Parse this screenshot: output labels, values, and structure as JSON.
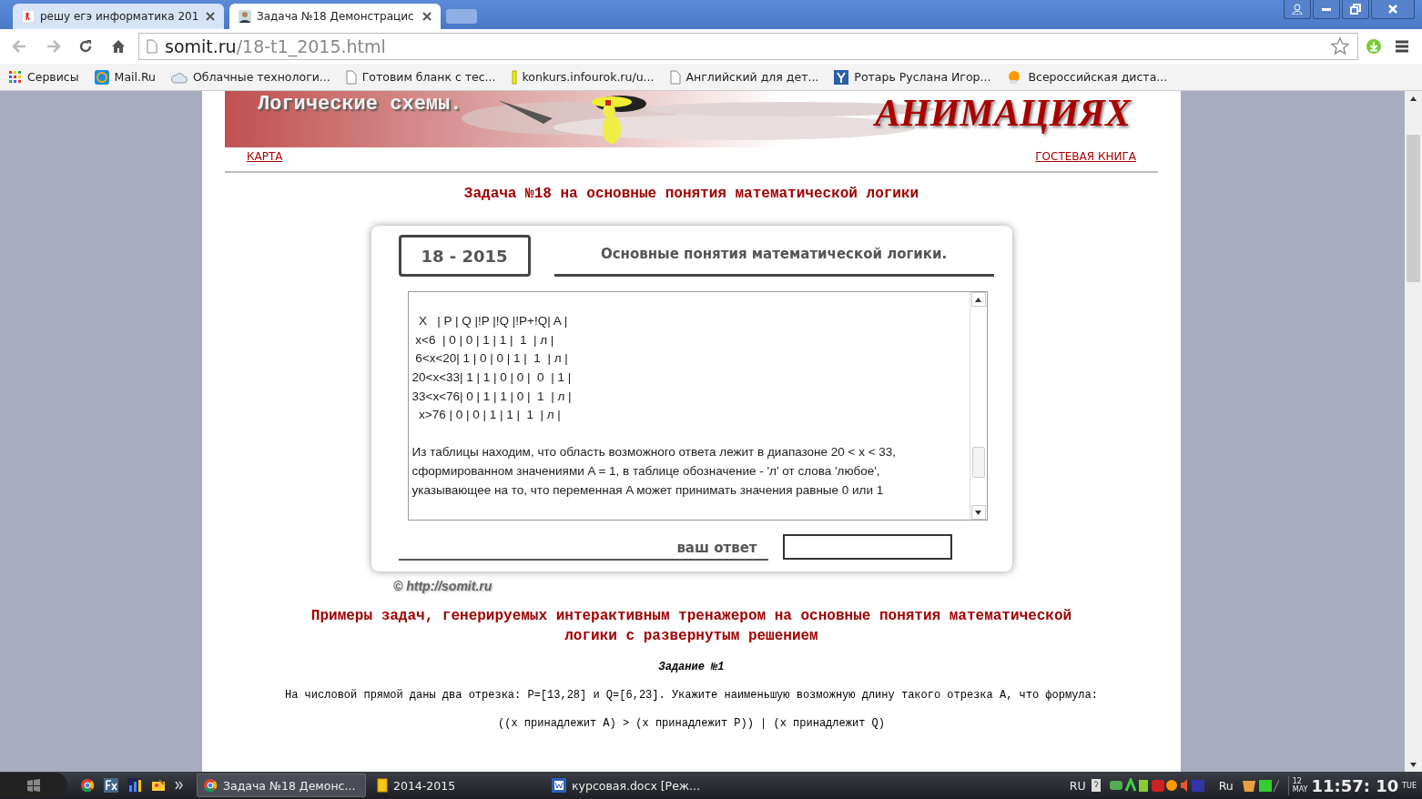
{
  "browser_tabs": [
    {
      "title": "решу егэ информатика 201",
      "selected": false
    },
    {
      "title": "Задача №18 Демонстрацис",
      "selected": true
    }
  ],
  "address_bar": {
    "host": "somit.ru",
    "path": "/18-t1_2015.html"
  },
  "bookmarks": [
    "Сервисы",
    "Mail.Ru",
    "Облачные технологи...",
    "Готовим бланк с тес...",
    "konkurs.infourok.ru/u...",
    "Английский для дет...",
    "Ротарь Руслана Игор...",
    "Всероссийская диста..."
  ],
  "banner": {
    "left_text": "Логические схемы.",
    "right_text": "АНИМАЦИЯХ"
  },
  "nav_links": [
    "КАРТА",
    "ГОСТЕВАЯ КНИГА"
  ],
  "heading": "Задача №18 на основные понятия математической логики",
  "card": {
    "tab_label": "18 - 2015",
    "title": "Основные понятия математической логики.",
    "solution_lines": [
      "  X   | P | Q |!P |!Q |!P+!Q| A |",
      " x<6  | 0 | 0 | 1 | 1 |  1  | л |",
      " 6<x<20| 1 | 0 | 0 | 1 |  1  | л |",
      "20<x<33| 1 | 1 | 0 | 0 |  0  | 1 |",
      "33<x<76| 0 | 1 | 1 | 0 |  1  | л |",
      "  x>76 | 0 | 0 | 1 | 1 |  1  | л |"
    ],
    "solution_text": "   Из таблицы находим, что область возможного ответа лежит в диапазоне 20 < x < 33, сформированном значениями A = 1, в таблице обозначение - 'л' от слова 'любое', указывающее на то, что переменная A может принимать значения равные 0 или 1",
    "answer_label": "ваш ответ"
  },
  "copyright": "© http://somit.ru",
  "examples_heading": "Примеры задач, генерируемых интерактивным тренажером на основные понятия математической логики с развернутым решением",
  "task_title": "Задание №1",
  "task_text": "На числовой прямой даны два отрезка: P=[13,28] и Q=[6,23]. Укажите наименьшую возможную длину такого отрезка A, что формула:",
  "formula": "((x принадлежит A) > (x принадлежит P)) | (x принадлежит Q)",
  "taskbar": {
    "windows": [
      "Задача №18 Демонс...",
      "2014-2015",
      "курсовая.docx [Реж..."
    ],
    "language": "RU",
    "tray_language": "Ru",
    "date_day": "12",
    "date_month": "MAY",
    "time": "11:57: 10",
    "weekday": "TUE"
  }
}
